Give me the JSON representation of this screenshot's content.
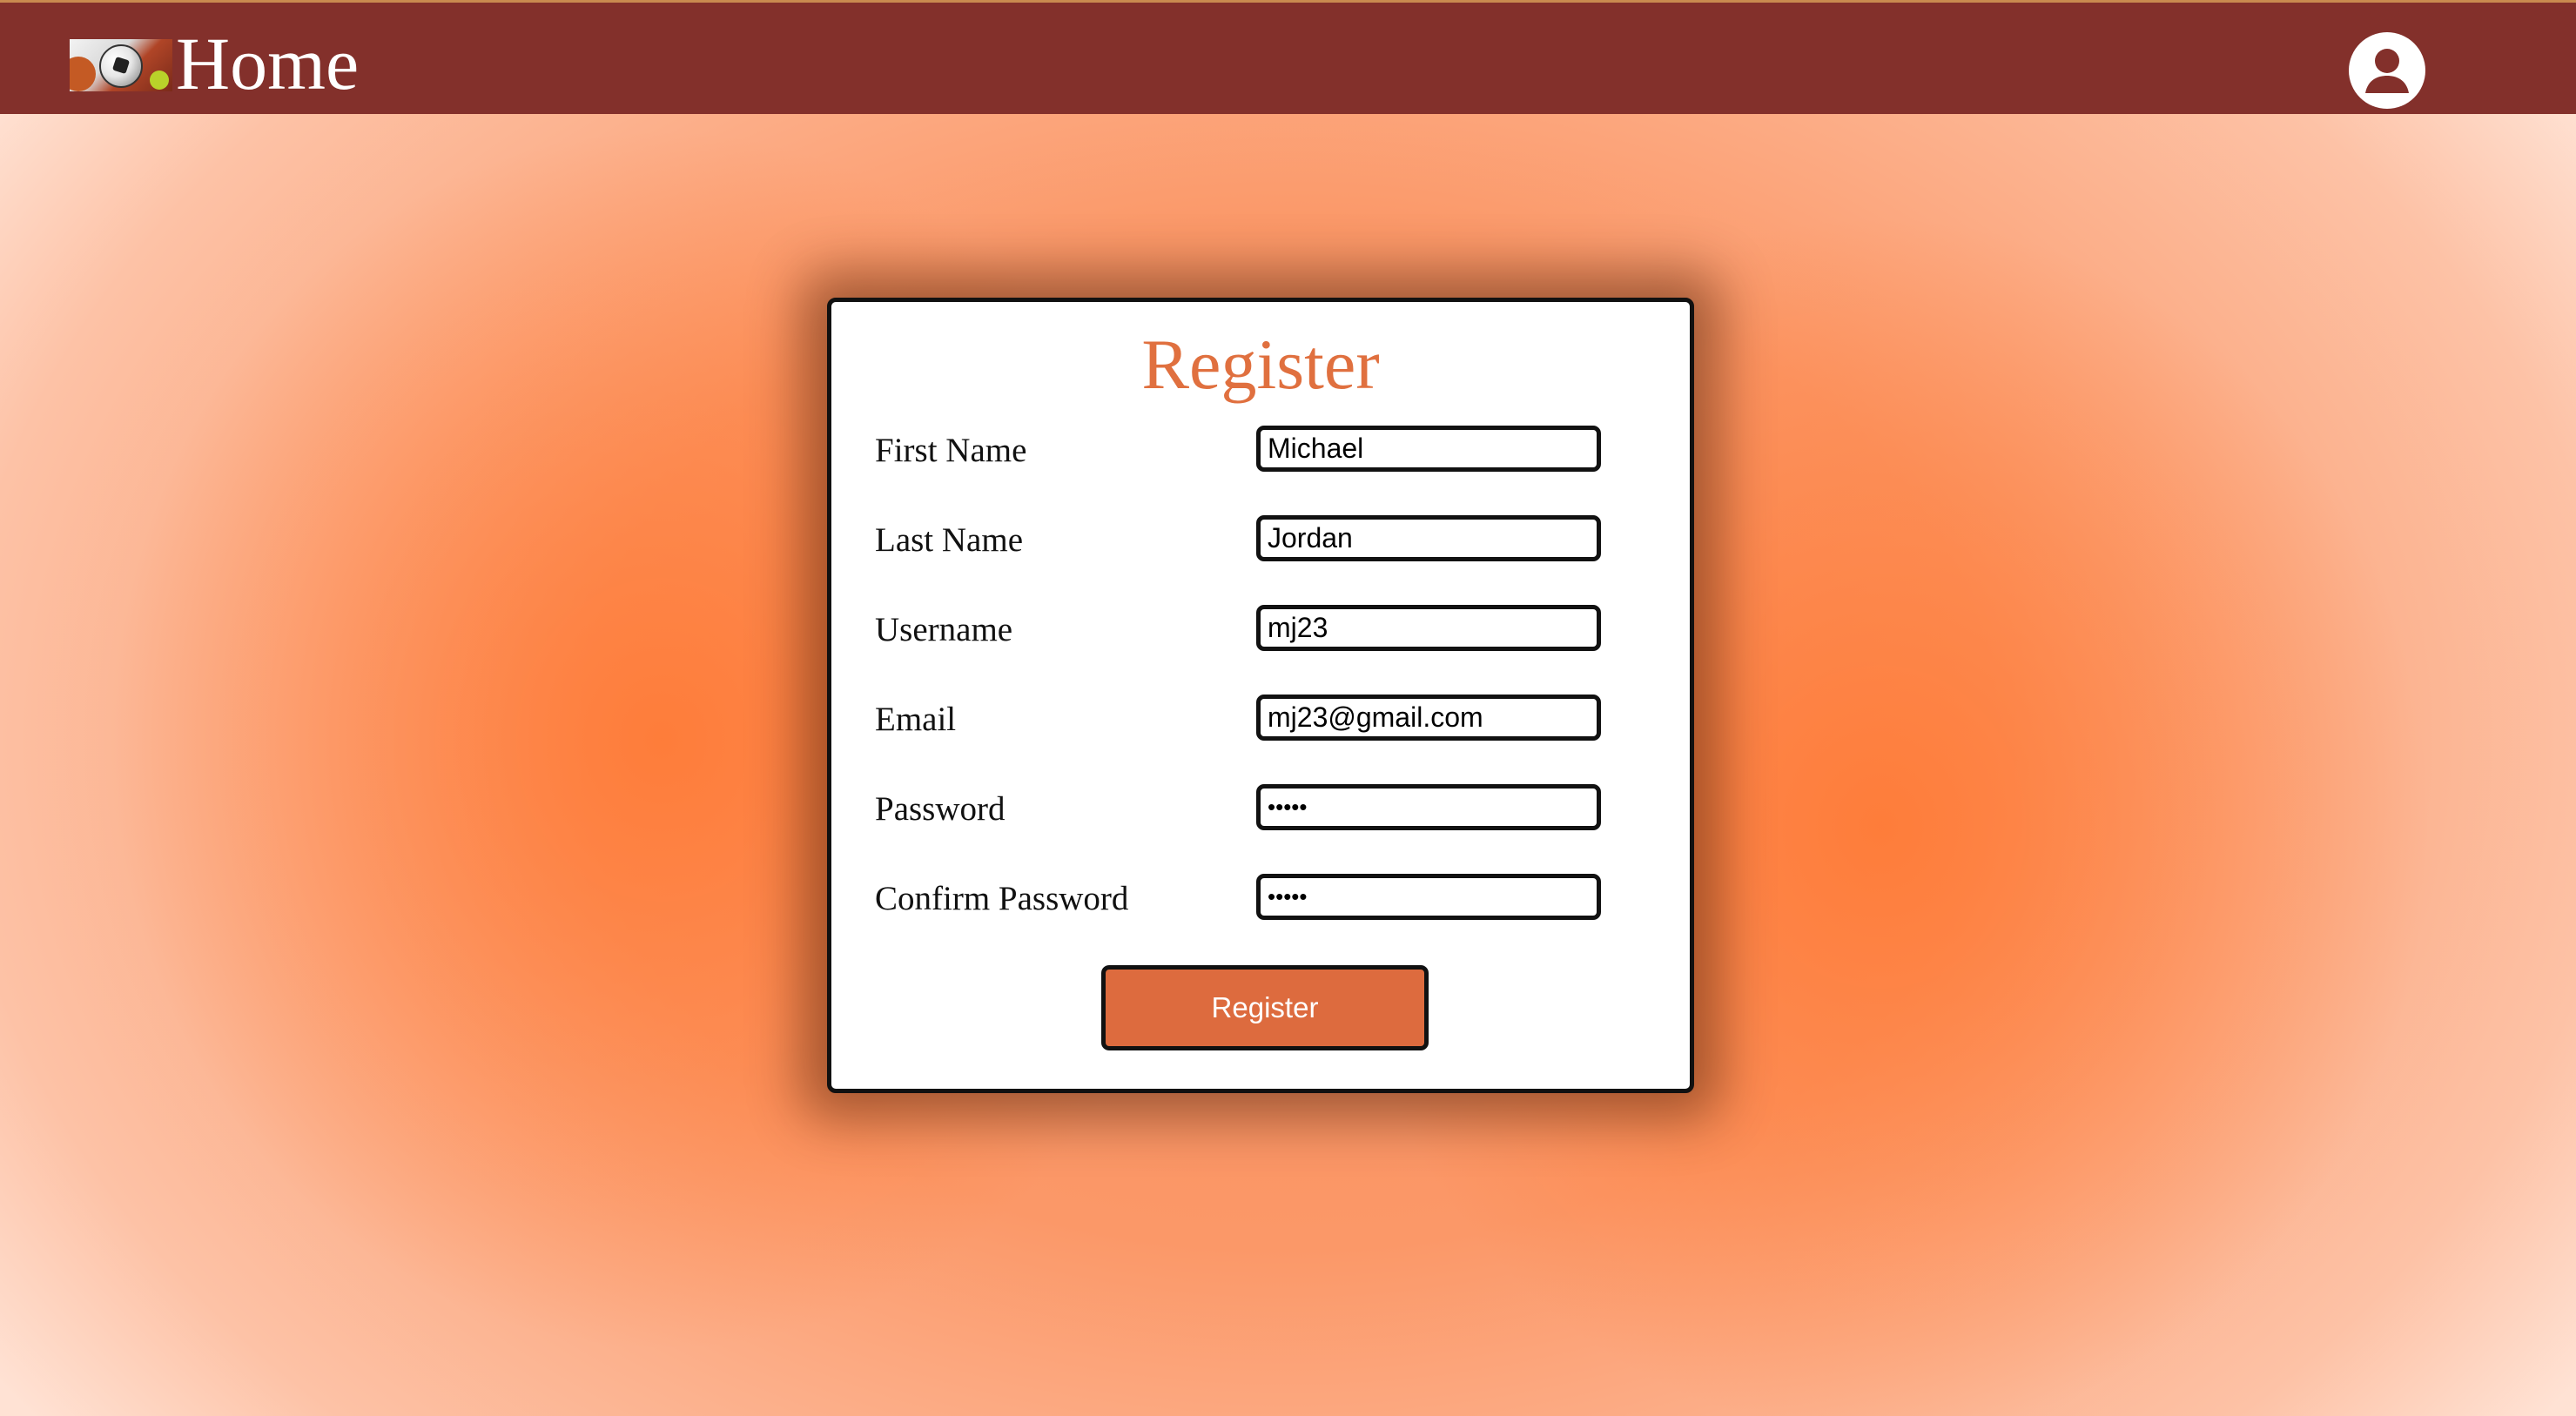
{
  "header": {
    "home_label": "Home",
    "logo_alt": "sports balls logo",
    "account_icon": "user-circle-icon"
  },
  "colors": {
    "header_bg": "#83302b",
    "accent": "#dd6b3e",
    "title": "#e0703f",
    "page_bg": "#f9a47c"
  },
  "form": {
    "title": "Register",
    "fields": [
      {
        "label": "First Name",
        "type": "text",
        "value": "Michael"
      },
      {
        "label": "Last Name",
        "type": "text",
        "value": "Jordan"
      },
      {
        "label": "Username",
        "type": "text",
        "value": "mj23"
      },
      {
        "label": "Email",
        "type": "text",
        "value": "mj23@gmail.com"
      },
      {
        "label": "Password",
        "type": "password",
        "value": "•••••"
      },
      {
        "label": "Confirm Password",
        "type": "password",
        "value": "•••••"
      }
    ],
    "submit_label": "Register"
  }
}
